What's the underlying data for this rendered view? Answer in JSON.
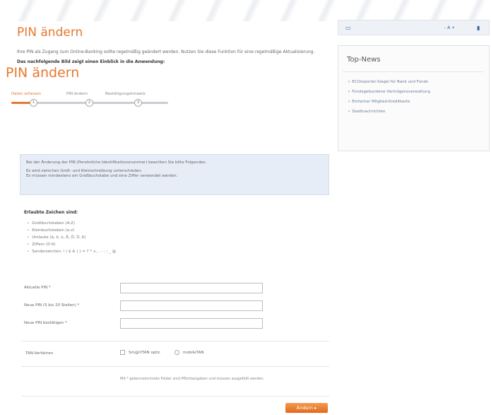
{
  "page": {
    "title": "PIN ändern",
    "intro": "Ihre PIN als Zugang zum Online-Banking sollte regelmäßig geändert werden. Nutzen Sie diese Funktion für eine regelmäßige Aktualisierung.",
    "intro_bold": "Das nachfolgende Bild zeigt einen Einblick in die Anwendung:"
  },
  "app": {
    "title": "PIN ändern",
    "steps": [
      {
        "label": "Daten erfassen",
        "number": "1"
      },
      {
        "label": "PIN ändern",
        "number": "2"
      },
      {
        "label": "Bestätigungshinweis",
        "number": "3"
      }
    ],
    "info": {
      "line1": "Bei der Änderung der PIN (Persönliche Identifikationsnummer) beachten Sie bitte Folgendes:",
      "line2": "Es wird zwischen Groß- und Kleinschreibung unterschieden.",
      "line3": "Es müssen mindestens ein Großbuchstabe und eine Ziffer verwendet werden."
    },
    "allowed_heading": "Erlaubte Zeichen sind:",
    "allowed": [
      "Großbuchstaben (A-Z)",
      "Kleinbuchstaben (a-z)",
      "Umlaute (ä, ö, ü, Ä, Ö, Ü, ß)",
      "Ziffern (0-9)",
      "Sonderzeichen: ! / $ & ( ) = ? * +, . - : ; _ @"
    ],
    "fields": {
      "current_pin": "Aktuelle PIN *",
      "new_pin": "Neue PIN (5 bis 20 Stellen) *",
      "confirm_pin": "Neue PIN bestätigen *"
    },
    "tan": {
      "label": "TAN-Verfahren",
      "option1": "Sm@rtTAN optic",
      "option2": "mobileTAN"
    },
    "footnote": "Mit * gekennzeichnete Felder sind Pflichtangaben und müssen ausgefüllt werden.",
    "submit_label": "Ändern ▸"
  },
  "sidebar": {
    "toolbar": {
      "left_icon": "print-icon",
      "font_label": "- A +",
      "right_icon": "bookmark-icon"
    },
    "news_title": "Top-News",
    "news": [
      "ECOreporter-Siegel für Bank und Fonds",
      "Fondsgebundene Vermögensverwaltung",
      "Einfacher Mitglied-Kreditkarte",
      "Stadtnachrichten"
    ]
  }
}
